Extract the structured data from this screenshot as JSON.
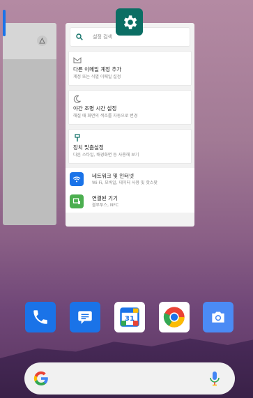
{
  "settings_card": {
    "search_placeholder": "설정 검색",
    "blocks": [
      {
        "title": "다른 이메일 계정 추가",
        "subtitle": "계정 또는 식별 이메일 설정"
      },
      {
        "title": "야간 조명 시간 설정",
        "subtitle": "해질 때 화면의 색조를 자동으로 변경"
      },
      {
        "title": "장치 맞춤설정",
        "subtitle": "다른 스타일, 배경화면 등 사용해 보기"
      }
    ],
    "rows": [
      {
        "title": "네트워크 및 인터넷",
        "subtitle": "Wi-Fi, 모바일, 데이터 사용 및 핫스팟"
      },
      {
        "title": "연결된 기기",
        "subtitle": "블루투스, NFC"
      }
    ]
  },
  "dock": {
    "apps": [
      "phone",
      "messages",
      "calendar",
      "chrome",
      "camera"
    ],
    "calendar_day": "31"
  },
  "colors": {
    "settings_teal": "#0b6e64",
    "dock_blue": "#1a73e8",
    "wifi_blue": "#1a73e8",
    "devices_green": "#4caf50"
  }
}
